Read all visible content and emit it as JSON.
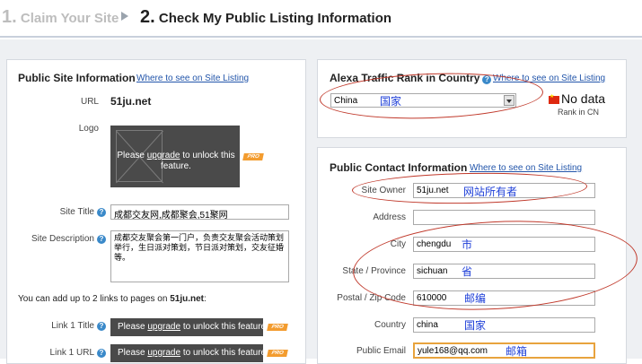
{
  "steps": {
    "step1_num": "1.",
    "step1_label": "Claim Your Site",
    "step2_num": "2.",
    "step2_label": "Check My Public Listing Information"
  },
  "left_panel": {
    "title": "Public Site Information",
    "where_link": "Where to see on Site Listing",
    "url_label": "URL",
    "url_value": "51ju.net",
    "logo_label": "Logo",
    "logo_upgrade": {
      "pre": "Please ",
      "link": "upgrade",
      "post": " to unlock this feature."
    },
    "site_title_label": "Site Title",
    "site_title_value": "成都交友网,成都聚会,51聚网",
    "site_desc_label": "Site Description",
    "site_desc_value": "成都交友聚会第一门户，负责交友聚会活动策划举行，生日派对策划，节日派对策划，交友征婚等。",
    "links_note_pre": "You can add up to 2 links to pages on ",
    "links_note_site": "51ju.net",
    "links_note_post": ":",
    "link1_title_label": "Link 1 Title",
    "link1_url_label": "Link 1 URL",
    "lock": {
      "pre": "Please ",
      "link": "upgrade",
      "post": " to unlock this feature."
    },
    "pro_badge": "PRO"
  },
  "alexa_panel": {
    "title": "Alexa Traffic Rank in Country",
    "where_link": "Where to see on Site Listing",
    "country_select": "China",
    "annotation": "国家",
    "nodata": "No data",
    "rank_label": "Rank in CN"
  },
  "contact_panel": {
    "title": "Public Contact Information",
    "where_link": "Where to see on Site Listing",
    "fields": [
      {
        "label": "Site Owner",
        "value": "51ju.net",
        "annotation": "网站所有者"
      },
      {
        "label": "Address",
        "value": "",
        "annotation": ""
      },
      {
        "label": "City",
        "value": "chengdu",
        "annotation": "市"
      },
      {
        "label": "State / Province",
        "value": "sichuan",
        "annotation": "省"
      },
      {
        "label": "Postal / Zip Code",
        "value": "610000",
        "annotation": "邮编"
      },
      {
        "label": "Country",
        "value": "china",
        "annotation": "国家"
      },
      {
        "label": "Public Email",
        "value": "yule168@qq.com",
        "annotation": "邮箱"
      }
    ]
  },
  "colors": {
    "accent_link": "#2255aa",
    "help_icon": "#3a89c9",
    "pro_badge": "#f39c2f",
    "annotation_ink": "#c0392b",
    "annotation_text": "#1e3fd8"
  }
}
